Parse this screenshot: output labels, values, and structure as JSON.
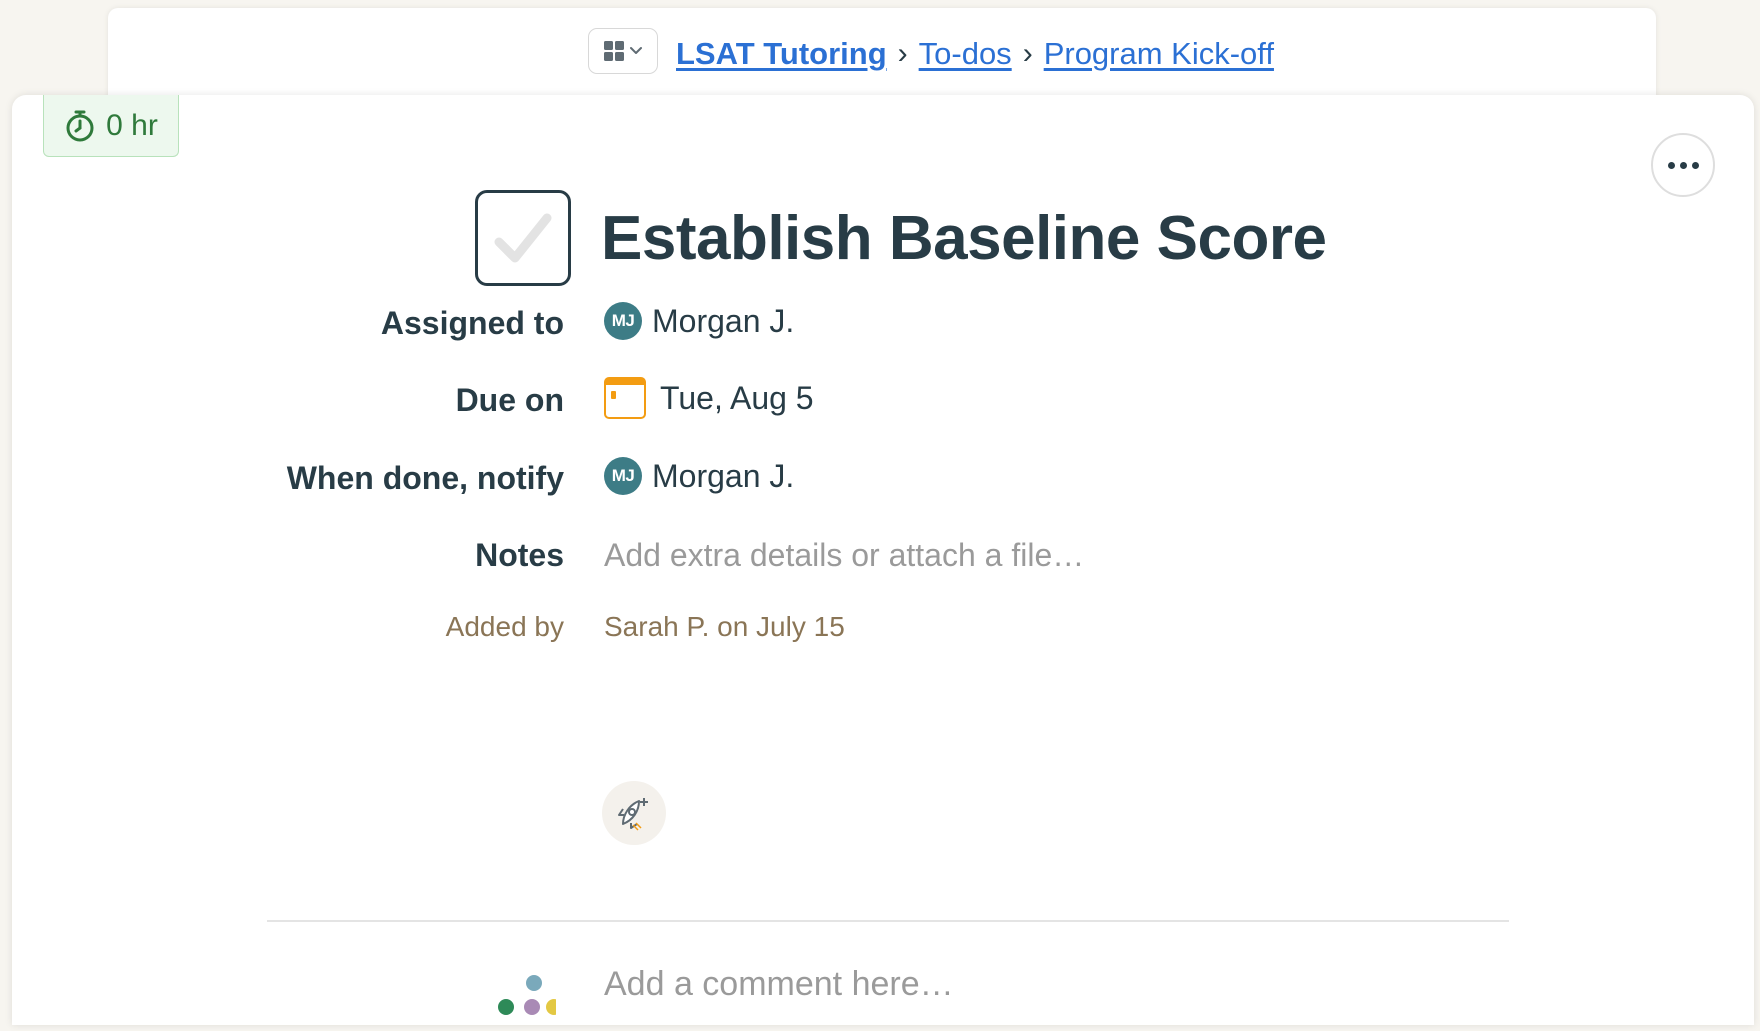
{
  "breadcrumb": {
    "project": "LSAT Tutoring",
    "section": "To-dos",
    "list": "Program Kick-off",
    "separator": "›"
  },
  "timer": {
    "label": "0 hr",
    "icon": "stopwatch-icon"
  },
  "todo": {
    "title": "Establish Baseline Score",
    "completed": false
  },
  "fields": {
    "assigned_label": "Assigned to",
    "assigned_avatar": "MJ",
    "assigned_name": "Morgan J.",
    "due_label": "Due on",
    "due_value": "Tue, Aug 5",
    "notify_label": "When done, notify",
    "notify_avatar": "MJ",
    "notify_name": "Morgan J.",
    "notes_label": "Notes",
    "notes_placeholder": "Add extra details or attach a file…",
    "added_label": "Added by",
    "added_value": "Sarah P. on July 15"
  },
  "comment": {
    "placeholder": "Add a comment here…"
  },
  "colors": {
    "link": "#2b70d4",
    "avatar": "#3d7c86",
    "calendar": "#f39c12",
    "timer": "#2f7a3b",
    "meta": "#8a7556"
  }
}
